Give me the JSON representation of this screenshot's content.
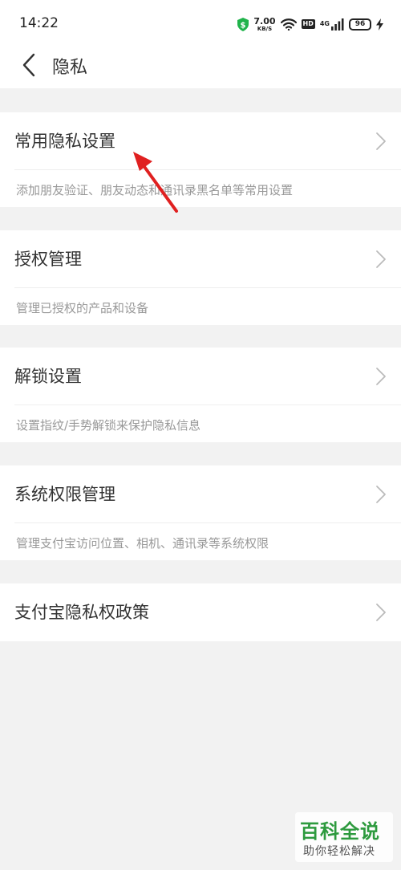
{
  "status_bar": {
    "time": "14:22",
    "net_speed_value": "7.00",
    "net_speed_unit": "KB/S",
    "hd_label": "HD",
    "signal_label": "4G",
    "battery": "96",
    "icons": [
      "shield-dollar-icon",
      "wifi-icon",
      "hd-icon",
      "signal-icon",
      "battery-icon",
      "charging-icon"
    ]
  },
  "nav": {
    "title": "隐私",
    "back_icon": "chevron-left-icon"
  },
  "sections": [
    {
      "title": "常用隐私设置",
      "desc": "添加朋友验证、朋友动态和通讯录黑名单等常用设置"
    },
    {
      "title": "授权管理",
      "desc": "管理已授权的产品和设备"
    },
    {
      "title": "解锁设置",
      "desc": "设置指纹/手势解锁来保护隐私信息"
    },
    {
      "title": "系统权限管理",
      "desc": "管理支付宝访问位置、相机、通讯录等系统权限"
    },
    {
      "title": "支付宝隐私权政策"
    }
  ],
  "annotation": {
    "color": "#e02020"
  },
  "watermark": {
    "main": "百科全说",
    "sub": "助你轻松解决",
    "color": "#2d9a3e"
  },
  "colors": {
    "background": "#f2f2f2",
    "card": "#ffffff",
    "title_text": "#333333",
    "desc_text": "#999999",
    "chevron": "#bbbbbb"
  }
}
